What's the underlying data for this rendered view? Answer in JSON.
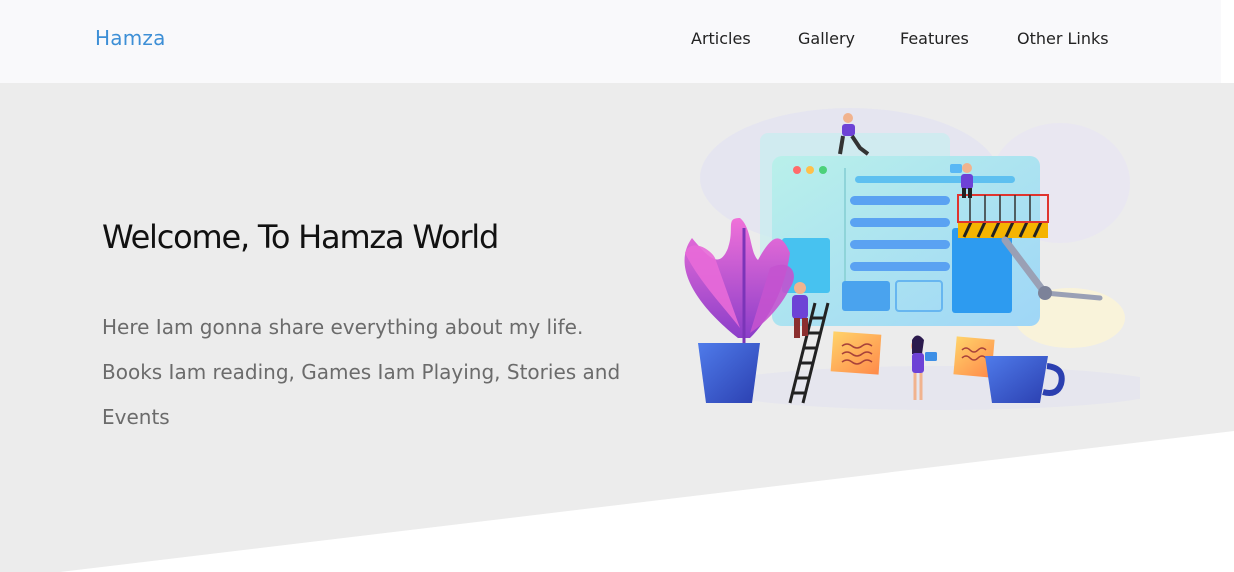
{
  "navbar": {
    "brand": "Hamza",
    "links": [
      "Articles",
      "Gallery",
      "Features",
      "Other Links"
    ]
  },
  "hero": {
    "title": "Welcome, To Hamza World",
    "lines": [
      "Here Iam gonna share everything about my life.",
      "Books Iam reading, Games Iam Playing, Stories and Events"
    ]
  },
  "colors": {
    "brand": "#3d8fd6",
    "navbar_bg": "#f9f9fb",
    "hero_bg": "#ececec",
    "text_dark": "#111111",
    "text_muted": "#6b6b6b"
  }
}
